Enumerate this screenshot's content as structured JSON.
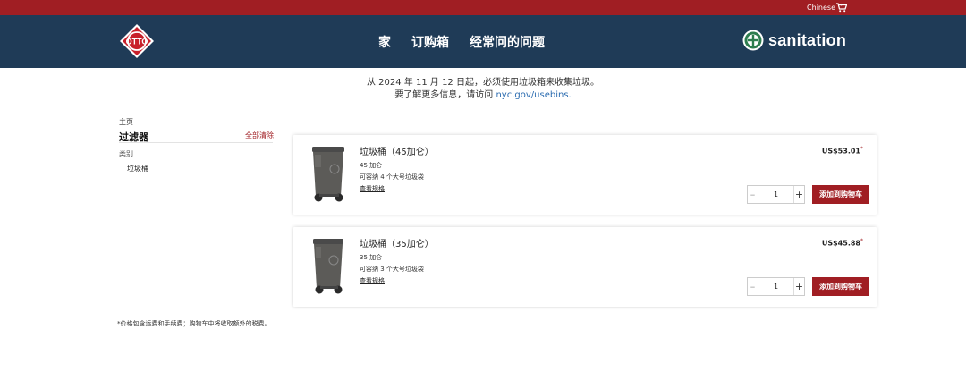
{
  "topbar": {
    "language": "Chinese",
    "cart_icon": "cart-icon",
    "color": "#a01e23"
  },
  "header": {
    "brand_logo": "OTTO",
    "nav": {
      "home": "家",
      "order": "订购箱",
      "faq": "经常问的问题"
    },
    "partner_logo_text": "sanitation",
    "color": "#1f3b57"
  },
  "notice": {
    "line1": "从 2024 年 11 月 12 日起，必须使用垃圾箱来收集垃圾。",
    "line2_prefix": "要了解更多信息，请访问 ",
    "line2_link": "nyc.gov/usebins."
  },
  "sidebar": {
    "breadcrumb": "主页",
    "filter_title": "过滤器",
    "clear_all": "全部清除",
    "category_label": "类别",
    "category_item": "垃圾桶"
  },
  "products": [
    {
      "name": "垃圾桶（45加仑）",
      "capacity": "45 加仑",
      "bags": "可容纳 4 个大号垃圾袋",
      "spec_link": "查看规格",
      "price": "US$53.01",
      "price_mark": "*",
      "quantity": "1",
      "add_label": "添加到购物车"
    },
    {
      "name": "垃圾桶（35加仑）",
      "capacity": "35 加仑",
      "bags": "可容纳 3 个大号垃圾袋",
      "spec_link": "查看规格",
      "price": "US$45.88",
      "price_mark": "*",
      "quantity": "1",
      "add_label": "添加到购物车"
    }
  ],
  "footnote": "*价格包含运费和手续费；购物车中将收取额外的税费。",
  "colors": {
    "accent": "#a01e23",
    "navy": "#1f3b57",
    "link": "#2b6cb0"
  }
}
